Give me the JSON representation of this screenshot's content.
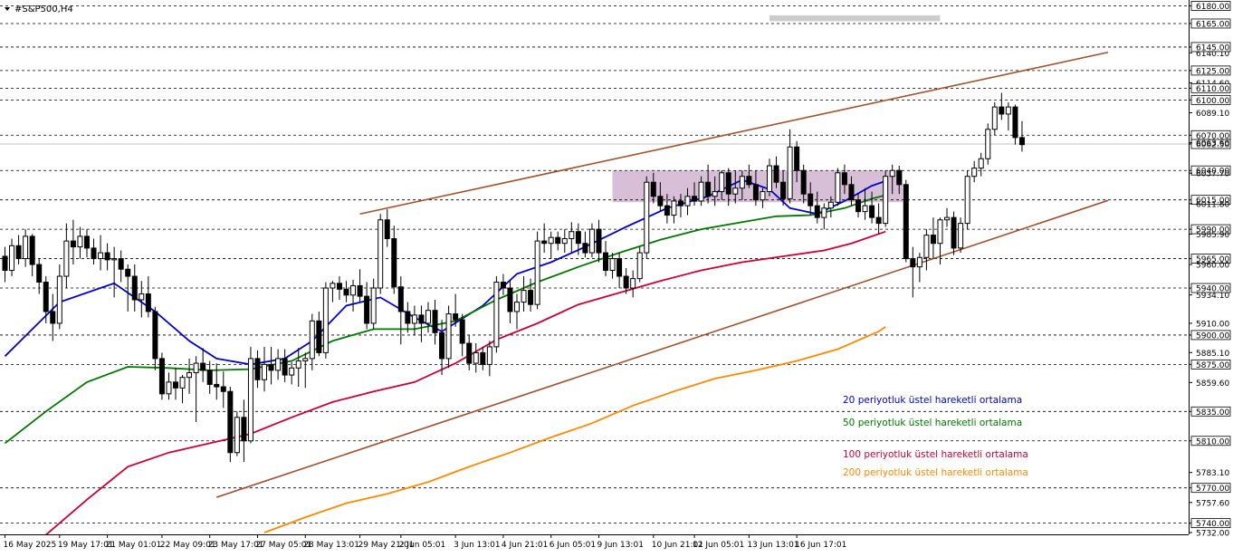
{
  "chart_data": {
    "type": "candlestick",
    "symbol_label": "#S&P500,H4",
    "symbol": "#S&P500",
    "timeframe": "H4",
    "ylim": [
      5732,
      6180
    ],
    "grid": false,
    "y_ticks": [
      "6180.00",
      "6165.00",
      "6140.10",
      "6145.00",
      "6125.00",
      "6114.60",
      "6110.00",
      "6100.00",
      "6089.10",
      "6070.00",
      "6062.50",
      "6063.60",
      "6040.00",
      "6037.70",
      "6015.00",
      "6011.80",
      "5990.00",
      "5985.90",
      "5965.00",
      "5960.00",
      "5940.00",
      "5934.10",
      "5910.00",
      "5900.00",
      "5885.10",
      "5875.00",
      "5859.60",
      "5835.00",
      "5810.00",
      "5783.10",
      "5770.00",
      "5757.60",
      "5740.00",
      "5732.00"
    ],
    "x_ticks": [
      {
        "t": 0,
        "label": "16 May 2025"
      },
      {
        "t": 8,
        "label": "19 May 17:01"
      },
      {
        "t": 15,
        "label": "21 May 01:01"
      },
      {
        "t": 23,
        "label": "22 May 09:01"
      },
      {
        "t": 30,
        "label": "23 May 17:01"
      },
      {
        "t": 37,
        "label": "27 May 05:01"
      },
      {
        "t": 44,
        "label": "28 May 13:01"
      },
      {
        "t": 52,
        "label": "29 May 21:01"
      },
      {
        "t": 58,
        "label": "2 Jun 05:01"
      },
      {
        "t": 66,
        "label": "3 Jun 13:01"
      },
      {
        "t": 73,
        "label": "4 Jun 21:01"
      },
      {
        "t": 80,
        "label": "6 Jun 05:01"
      },
      {
        "t": 87,
        "label": "9 Jun 13:01"
      },
      {
        "t": 95,
        "label": "10 Jun 21:01"
      },
      {
        "t": 101,
        "label": "12 Jun 05:01"
      },
      {
        "t": 109,
        "label": "13 Jun 13:01"
      },
      {
        "t": 116,
        "label": "16 Jun 17:01"
      }
    ],
    "horizontal_levels": [
      6180,
      6165,
      6145,
      6125,
      6110,
      6100,
      6070,
      6040,
      6015,
      5990,
      5965,
      5940,
      5900,
      5875,
      5835,
      5810,
      5770,
      5740
    ],
    "current_price": 6062.5,
    "candles": [
      [
        5967,
        5975,
        5945,
        5955
      ],
      [
        5955,
        5982,
        5950,
        5976
      ],
      [
        5976,
        5985,
        5960,
        5965
      ],
      [
        5965,
        5990,
        5958,
        5984
      ],
      [
        5984,
        5986,
        5950,
        5960
      ],
      [
        5960,
        5965,
        5935,
        5945
      ],
      [
        5945,
        5950,
        5910,
        5920
      ],
      [
        5920,
        5935,
        5895,
        5910
      ],
      [
        5910,
        5960,
        5905,
        5950
      ],
      [
        5950,
        5995,
        5940,
        5980
      ],
      [
        5980,
        5998,
        5960,
        5975
      ],
      [
        5975,
        5992,
        5965,
        5984
      ],
      [
        5984,
        5990,
        5966,
        5974
      ],
      [
        5974,
        5982,
        5960,
        5965
      ],
      [
        5965,
        5985,
        5955,
        5970
      ],
      [
        5970,
        5978,
        5955,
        5964
      ],
      [
        5964,
        5975,
        5932,
        5965
      ],
      [
        5965,
        5972,
        5945,
        5956
      ],
      [
        5956,
        5960,
        5920,
        5950
      ],
      [
        5950,
        5960,
        5920,
        5930
      ],
      [
        5930,
        5946,
        5915,
        5935
      ],
      [
        5935,
        5950,
        5915,
        5920
      ],
      [
        5920,
        5924,
        5870,
        5880
      ],
      [
        5880,
        5885,
        5845,
        5850
      ],
      [
        5850,
        5868,
        5845,
        5860
      ],
      [
        5860,
        5872,
        5845,
        5855
      ],
      [
        5855,
        5866,
        5842,
        5864
      ],
      [
        5864,
        5880,
        5850,
        5868
      ],
      [
        5868,
        5882,
        5826,
        5876
      ],
      [
        5876,
        5889,
        5860,
        5870
      ],
      [
        5870,
        5878,
        5850,
        5858
      ],
      [
        5858,
        5876,
        5845,
        5856
      ],
      [
        5856,
        5869,
        5838,
        5852
      ],
      [
        5852,
        5856,
        5792,
        5800
      ],
      [
        5800,
        5835,
        5797,
        5830
      ],
      [
        5830,
        5845,
        5792,
        5810
      ],
      [
        5810,
        5890,
        5808,
        5880
      ],
      [
        5880,
        5887,
        5855,
        5862
      ],
      [
        5862,
        5890,
        5852,
        5875
      ],
      [
        5875,
        5890,
        5858,
        5870
      ],
      [
        5870,
        5888,
        5862,
        5880
      ],
      [
        5880,
        5888,
        5860,
        5866
      ],
      [
        5866,
        5877,
        5858,
        5872
      ],
      [
        5872,
        5889,
        5856,
        5878
      ],
      [
        5878,
        5885,
        5855,
        5880
      ],
      [
        5880,
        5918,
        5870,
        5912
      ],
      [
        5912,
        5920,
        5882,
        5885
      ],
      [
        5885,
        5945,
        5880,
        5940
      ],
      [
        5940,
        5946,
        5928,
        5944
      ],
      [
        5944,
        5950,
        5930,
        5939
      ],
      [
        5939,
        5946,
        5928,
        5934
      ],
      [
        5934,
        5947,
        5920,
        5942
      ],
      [
        5942,
        5956,
        5928,
        5933
      ],
      [
        5933,
        5945,
        5905,
        5910
      ],
      [
        5910,
        5948,
        5905,
        5940
      ],
      [
        5940,
        6003,
        5935,
        5998
      ],
      [
        5998,
        6007,
        5975,
        5982
      ],
      [
        5982,
        5993,
        5935,
        5941
      ],
      [
        5941,
        5950,
        5892,
        5920
      ],
      [
        5920,
        5928,
        5902,
        5910
      ],
      [
        5910,
        5925,
        5900,
        5917
      ],
      [
        5917,
        5925,
        5894,
        5910
      ],
      [
        5910,
        5928,
        5902,
        5921
      ],
      [
        5921,
        5930,
        5892,
        5902
      ],
      [
        5902,
        5913,
        5866,
        5880
      ],
      [
        5880,
        5925,
        5872,
        5918
      ],
      [
        5918,
        5935,
        5907,
        5913
      ],
      [
        5913,
        5918,
        5882,
        5893
      ],
      [
        5893,
        5900,
        5870,
        5876
      ],
      [
        5876,
        5893,
        5868,
        5885
      ],
      [
        5885,
        5890,
        5870,
        5875
      ],
      [
        5875,
        5895,
        5865,
        5890
      ],
      [
        5890,
        5950,
        5885,
        5945
      ],
      [
        5945,
        5952,
        5934,
        5940
      ],
      [
        5940,
        5946,
        5910,
        5920
      ],
      [
        5920,
        5935,
        5905,
        5928
      ],
      [
        5928,
        5950,
        5920,
        5938
      ],
      [
        5938,
        5948,
        5920,
        5926
      ],
      [
        5926,
        5988,
        5922,
        5980
      ],
      [
        5980,
        5995,
        5970,
        5978
      ],
      [
        5978,
        5988,
        5965,
        5983
      ],
      [
        5983,
        5988,
        5972,
        5978
      ],
      [
        5978,
        5990,
        5970,
        5982
      ],
      [
        5982,
        5996,
        5970,
        5988
      ],
      [
        5988,
        5995,
        5968,
        5978
      ],
      [
        5978,
        5988,
        5966,
        5970
      ],
      [
        5970,
        5995,
        5966,
        5990
      ],
      [
        5990,
        5998,
        5962,
        5970
      ],
      [
        5970,
        5980,
        5950,
        5955
      ],
      [
        5955,
        5970,
        5948,
        5965
      ],
      [
        5965,
        5970,
        5940,
        5950
      ],
      [
        5950,
        5957,
        5935,
        5940
      ],
      [
        5940,
        5955,
        5932,
        5948
      ],
      [
        5948,
        5975,
        5945,
        5970
      ],
      [
        5970,
        6035,
        5965,
        6030
      ],
      [
        6030,
        6038,
        6012,
        6018
      ],
      [
        6018,
        6030,
        6005,
        6010
      ],
      [
        6010,
        6020,
        5995,
        6002
      ],
      [
        6002,
        6018,
        5995,
        6014
      ],
      [
        6014,
        6020,
        6000,
        6010
      ],
      [
        6010,
        6025,
        6002,
        6018
      ],
      [
        6018,
        6030,
        6010,
        6014
      ],
      [
        6014,
        6035,
        6010,
        6030
      ],
      [
        6030,
        6045,
        6012,
        6018
      ],
      [
        6018,
        6035,
        6010,
        6022
      ],
      [
        6022,
        6040,
        6015,
        6038
      ],
      [
        6038,
        6042,
        6010,
        6020
      ],
      [
        6020,
        6040,
        6012,
        6025
      ],
      [
        6025,
        6040,
        6015,
        6035
      ],
      [
        6035,
        6045,
        6025,
        6028
      ],
      [
        6028,
        6040,
        6010,
        6015
      ],
      [
        6015,
        6025,
        6008,
        6022
      ],
      [
        6022,
        6050,
        6018,
        6044
      ],
      [
        6044,
        6052,
        6025,
        6030
      ],
      [
        6030,
        6040,
        6010,
        6016
      ],
      [
        6016,
        6075,
        6012,
        6060
      ],
      [
        6060,
        6065,
        6030,
        6040
      ],
      [
        6040,
        6045,
        6012,
        6020
      ],
      [
        6020,
        6030,
        6002,
        6010
      ],
      [
        6010,
        6022,
        5995,
        6000
      ],
      [
        6000,
        6012,
        5990,
        6008
      ],
      [
        6008,
        6018,
        6000,
        6013
      ],
      [
        6013,
        6042,
        6010,
        6038
      ],
      [
        6038,
        6045,
        6020,
        6028
      ],
      [
        6028,
        6035,
        6010,
        6015
      ],
      [
        6015,
        6020,
        6000,
        6005
      ],
      [
        6005,
        6025,
        5998,
        6010
      ],
      [
        6010,
        6022,
        5995,
        6000
      ],
      [
        6000,
        6012,
        5986,
        5995
      ],
      [
        5995,
        6040,
        5992,
        6035
      ],
      [
        6035,
        6045,
        6020,
        6040
      ],
      [
        6040,
        6044,
        6020,
        6028
      ],
      [
        6028,
        6032,
        5962,
        5965
      ],
      [
        5965,
        5975,
        5932,
        5958
      ],
      [
        5958,
        5970,
        5945,
        5966
      ],
      [
        5966,
        5990,
        5955,
        5985
      ],
      [
        5985,
        6000,
        5965,
        5978
      ],
      [
        5978,
        6000,
        5960,
        5998
      ],
      [
        5998,
        6008,
        5992,
        6000
      ],
      [
        6000,
        6005,
        5968,
        5974
      ],
      [
        5974,
        6000,
        5970,
        5995
      ],
      [
        5995,
        6040,
        5990,
        6035
      ],
      [
        6035,
        6048,
        6030,
        6042
      ],
      [
        6042,
        6055,
        6035,
        6050
      ],
      [
        6050,
        6080,
        6045,
        6075
      ],
      [
        6075,
        6098,
        6070,
        6094
      ],
      [
        6094,
        6106,
        6083,
        6088
      ],
      [
        6088,
        6098,
        6074,
        6094
      ],
      [
        6094,
        6096,
        6062,
        6068
      ],
      [
        6068,
        6082,
        6056,
        6062
      ]
    ],
    "ema_series": [
      {
        "name": "20 periyotluk üstel hareketli ortalama",
        "color": "#0000cc",
        "points": [
          [
            0,
            5882
          ],
          [
            8,
            5928
          ],
          [
            16,
            5944
          ],
          [
            22,
            5920
          ],
          [
            27,
            5895
          ],
          [
            31,
            5880
          ],
          [
            36,
            5875
          ],
          [
            41,
            5880
          ],
          [
            45,
            5895
          ],
          [
            50,
            5925
          ],
          [
            55,
            5932
          ],
          [
            60,
            5915
          ],
          [
            64,
            5903
          ],
          [
            70,
            5925
          ],
          [
            75,
            5952
          ],
          [
            80,
            5962
          ],
          [
            85,
            5975
          ],
          [
            91,
            5992
          ],
          [
            97,
            6008
          ],
          [
            103,
            6018
          ],
          [
            108,
            6032
          ],
          [
            112,
            6024
          ],
          [
            115,
            6008
          ],
          [
            119,
            6003
          ],
          [
            123,
            6014
          ],
          [
            127,
            6027
          ],
          [
            129,
            6031
          ]
        ]
      },
      {
        "name": "50 periyotluk üstel hareketli ortalama",
        "color": "#007700",
        "points": [
          [
            0,
            5808
          ],
          [
            6,
            5835
          ],
          [
            12,
            5860
          ],
          [
            18,
            5873
          ],
          [
            24,
            5872
          ],
          [
            30,
            5870
          ],
          [
            36,
            5871
          ],
          [
            42,
            5878
          ],
          [
            48,
            5895
          ],
          [
            54,
            5905
          ],
          [
            60,
            5905
          ],
          [
            66,
            5912
          ],
          [
            72,
            5930
          ],
          [
            78,
            5945
          ],
          [
            84,
            5958
          ],
          [
            90,
            5970
          ],
          [
            96,
            5981
          ],
          [
            102,
            5990
          ],
          [
            108,
            5996
          ],
          [
            113,
            6001
          ],
          [
            118,
            6002
          ],
          [
            123,
            6008
          ],
          [
            127,
            6016
          ],
          [
            129,
            6019
          ]
        ]
      },
      {
        "name": "100 periyotluk üstel hareketli ortalama",
        "color": "#cc0033",
        "points": [
          [
            6,
            5730
          ],
          [
            12,
            5760
          ],
          [
            18,
            5788
          ],
          [
            24,
            5800
          ],
          [
            30,
            5808
          ],
          [
            36,
            5816
          ],
          [
            42,
            5830
          ],
          [
            48,
            5843
          ],
          [
            54,
            5852
          ],
          [
            60,
            5860
          ],
          [
            66,
            5876
          ],
          [
            72,
            5896
          ],
          [
            78,
            5910
          ],
          [
            84,
            5926
          ],
          [
            90,
            5936
          ],
          [
            96,
            5946
          ],
          [
            102,
            5955
          ],
          [
            108,
            5962
          ],
          [
            114,
            5967
          ],
          [
            120,
            5972
          ],
          [
            124,
            5978
          ],
          [
            129,
            5988
          ]
        ]
      },
      {
        "name": "200 periyotluk üstel hareketli ortalama",
        "color": "#ff8800",
        "points": [
          [
            38,
            5732
          ],
          [
            44,
            5745
          ],
          [
            50,
            5757
          ],
          [
            56,
            5765
          ],
          [
            62,
            5775
          ],
          [
            68,
            5788
          ],
          [
            74,
            5800
          ],
          [
            80,
            5813
          ],
          [
            86,
            5825
          ],
          [
            92,
            5840
          ],
          [
            98,
            5852
          ],
          [
            104,
            5863
          ],
          [
            110,
            5870
          ],
          [
            116,
            5878
          ],
          [
            122,
            5888
          ],
          [
            128,
            5903
          ],
          [
            129,
            5907
          ]
        ]
      }
    ],
    "trendlines": [
      {
        "color": "#a0522d",
        "from": [
          52,
          6003
        ],
        "to": [
          161.6,
          6140.5
        ]
      },
      {
        "color": "#a0522d",
        "from": [
          31,
          5762
        ],
        "to": [
          161.6,
          6014.5
        ]
      }
    ],
    "zones": [
      {
        "color": "#d8bfd8",
        "t_from": 89,
        "t_to": 131.5,
        "y_from": 6013,
        "y_to": 6040
      },
      {
        "color": "#cccccc",
        "t_from": 112,
        "t_to": 137,
        "y_from": 6167,
        "y_to": 6172
      }
    ],
    "annotations": [
      {
        "text": "20 periyotluk üstel hareketli ortalama",
        "color": "#0000cc"
      },
      {
        "text": "50 periyotluk üstel hareketli ortalama",
        "color": "#007700"
      },
      {
        "text": "100 periyotluk üstel hareketli ortalama",
        "color": "#cc0033"
      },
      {
        "text": "200 periyotluk üstel hareketli ortalama",
        "color": "#ff8800"
      }
    ]
  }
}
